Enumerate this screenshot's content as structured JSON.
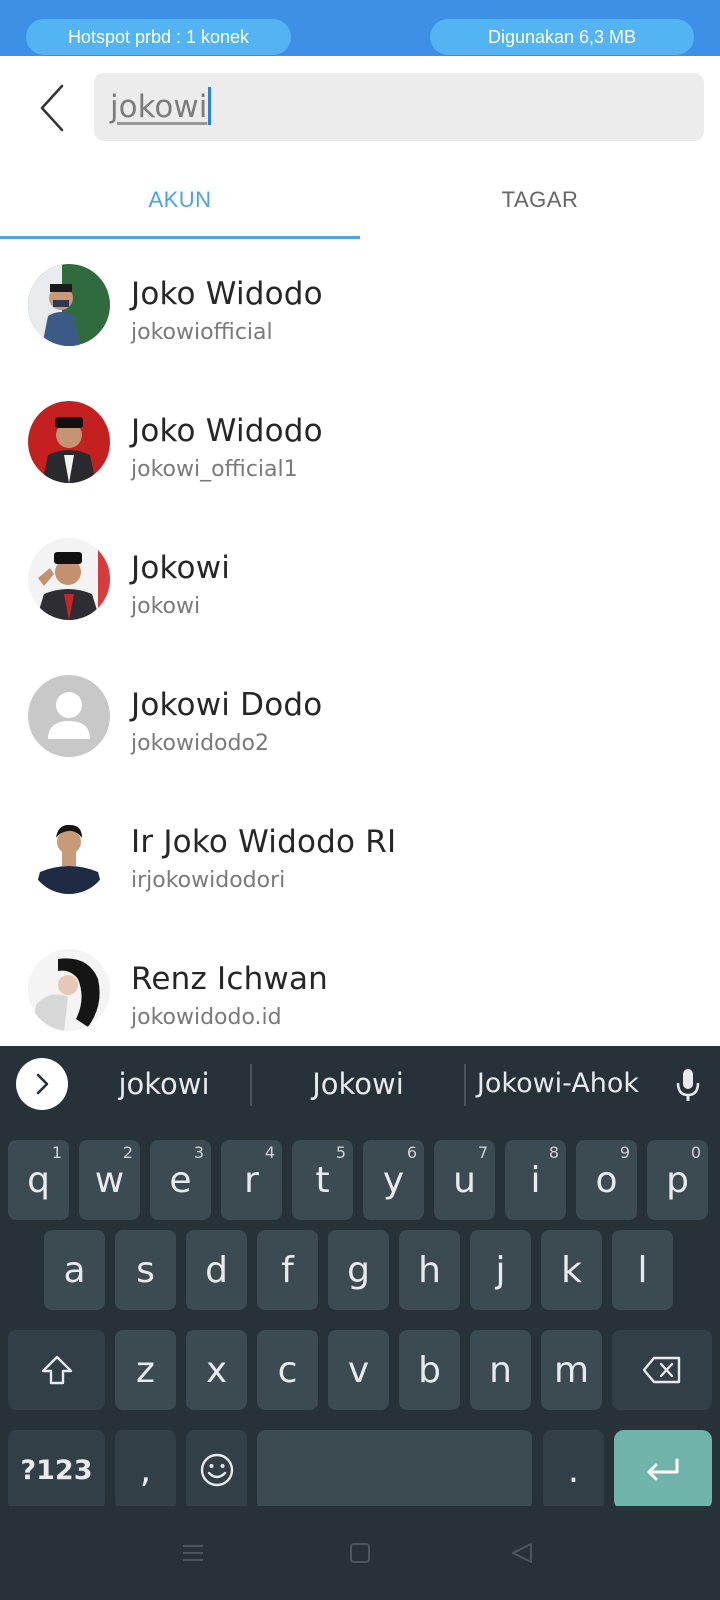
{
  "status_bar": {
    "hotspot": "Hotspot prbd : 1 konek",
    "data_used": "Digunakan 6,3 MB"
  },
  "search": {
    "query": "jokowi"
  },
  "tabs": {
    "accounts": "AKUN",
    "tags": "TAGAR",
    "active": "AKUN"
  },
  "results": [
    {
      "name": "Joko Widodo",
      "handle": "jokowiofficial"
    },
    {
      "name": "Joko Widodo",
      "handle": "jokowi_official1"
    },
    {
      "name": "Jokowi",
      "handle": "jokowi"
    },
    {
      "name": "Jokowi Dodo",
      "handle": "jokowidodo2"
    },
    {
      "name": "Ir Joko Widodo RI",
      "handle": "irjokowidodori"
    },
    {
      "name": "Renz Ichwan",
      "handle": "jokowidodo.id"
    }
  ],
  "keyboard": {
    "suggestions": [
      "jokowi",
      "Jokowi",
      "Jokowi-Ahok"
    ],
    "row1": [
      "q",
      "w",
      "e",
      "r",
      "t",
      "y",
      "u",
      "i",
      "o",
      "p"
    ],
    "row1_hints": [
      "1",
      "2",
      "3",
      "4",
      "5",
      "6",
      "7",
      "8",
      "9",
      "0"
    ],
    "row2": [
      "a",
      "s",
      "d",
      "f",
      "g",
      "h",
      "j",
      "k",
      "l"
    ],
    "row3": [
      "z",
      "x",
      "c",
      "v",
      "b",
      "n",
      "m"
    ],
    "symbols_label": "?123",
    "comma": ",",
    "period": "."
  },
  "colors": {
    "status_bar": "#3e8fe6",
    "pill": "#54b3f2",
    "accent": "#4aa3e8",
    "keyboard_bg": "#263238",
    "key_bg": "#3c4a51",
    "enter_key": "#6fb3aa"
  },
  "icons": {
    "back": "chevron-left-icon",
    "expand": "chevron-right-icon",
    "mic": "microphone-icon",
    "shift": "shift-icon",
    "backspace": "backspace-icon",
    "emoji": "emoji-icon",
    "enter": "enter-icon",
    "nav_menu": "menu-icon",
    "nav_home": "home-icon",
    "nav_back": "back-triangle-icon"
  }
}
